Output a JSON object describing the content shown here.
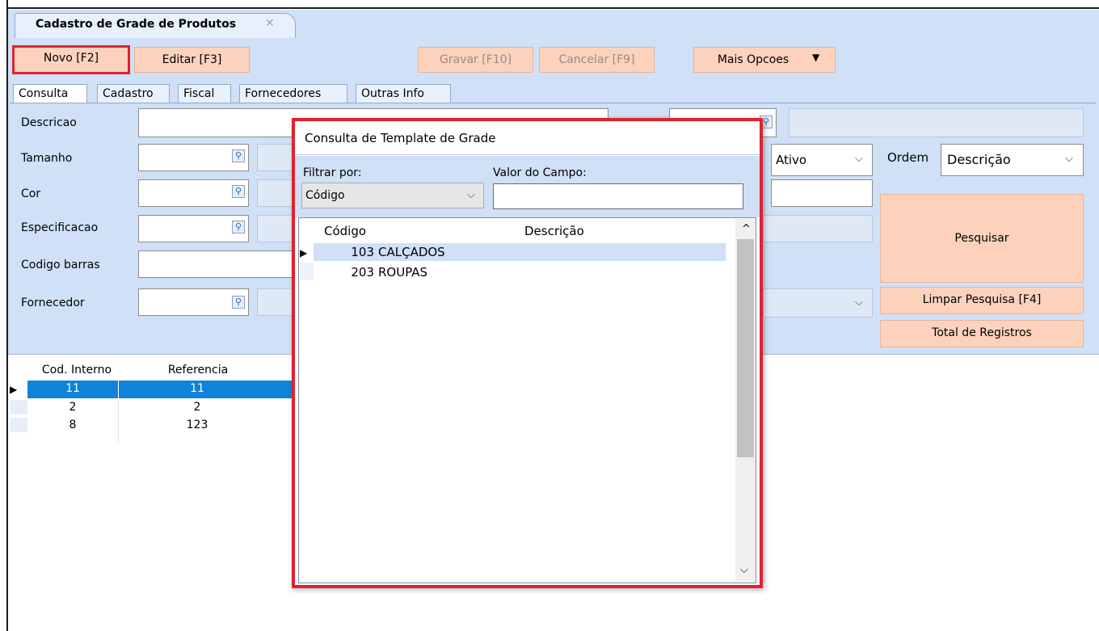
{
  "window": {
    "doc_tab_title": "Cadastro de Grade de Produtos",
    "doc_tab_close": "✕"
  },
  "toolbar": {
    "novo": "Novo [F2]",
    "editar": "Editar [F3]",
    "gravar": "Gravar [F10]",
    "cancelar": "Cancelar [F9]",
    "mais_opcoes": "Mais Opcoes",
    "mais_opcoes_arrow": "▼"
  },
  "tabs": [
    "Consulta",
    "Cadastro",
    "Fiscal",
    "Fornecedores",
    "Outras Info"
  ],
  "form": {
    "descricao_label": "Descricao",
    "tamanho_label": "Tamanho",
    "cor_label": "Cor",
    "especificacao_label": "Especificacao",
    "codigo_barras_label": "Codigo barras",
    "fornecedor_label": "Fornecedor",
    "status_value": "Ativo",
    "ordem_label": "Ordem",
    "ordem_value": "Descrição",
    "chevron": "⌵"
  },
  "actions": {
    "pesquisar": "Pesquisar",
    "limpar": "Limpar Pesquisa [F4]",
    "total": "Total de Registros"
  },
  "grid": {
    "columns": [
      "Cod. Interno",
      "Referencia"
    ],
    "rows": [
      {
        "cod": "11",
        "ref": "11"
      },
      {
        "cod": "2",
        "ref": "2"
      },
      {
        "cod": "8",
        "ref": "123"
      }
    ]
  },
  "modal": {
    "title": "Consulta de Template de Grade",
    "filtrar_label": "Filtrar por:",
    "filtrar_value": "Código",
    "valor_label": "Valor do Campo:",
    "valor_value": "",
    "columns": [
      "Código",
      "Descrição"
    ],
    "rows": [
      {
        "codigo": "103",
        "descricao": "CALÇADOS"
      },
      {
        "codigo": "203",
        "descricao": "ROUPAS"
      }
    ],
    "scroll_up": "^",
    "scroll_down": "⌵"
  },
  "icons": {
    "row_indicator": "▶",
    "lupa": "search-icon"
  },
  "colors": {
    "highlight": "#e0222e",
    "button": "#fcd2bc",
    "panel": "#cfe0f7",
    "selection": "#0f83d9"
  }
}
